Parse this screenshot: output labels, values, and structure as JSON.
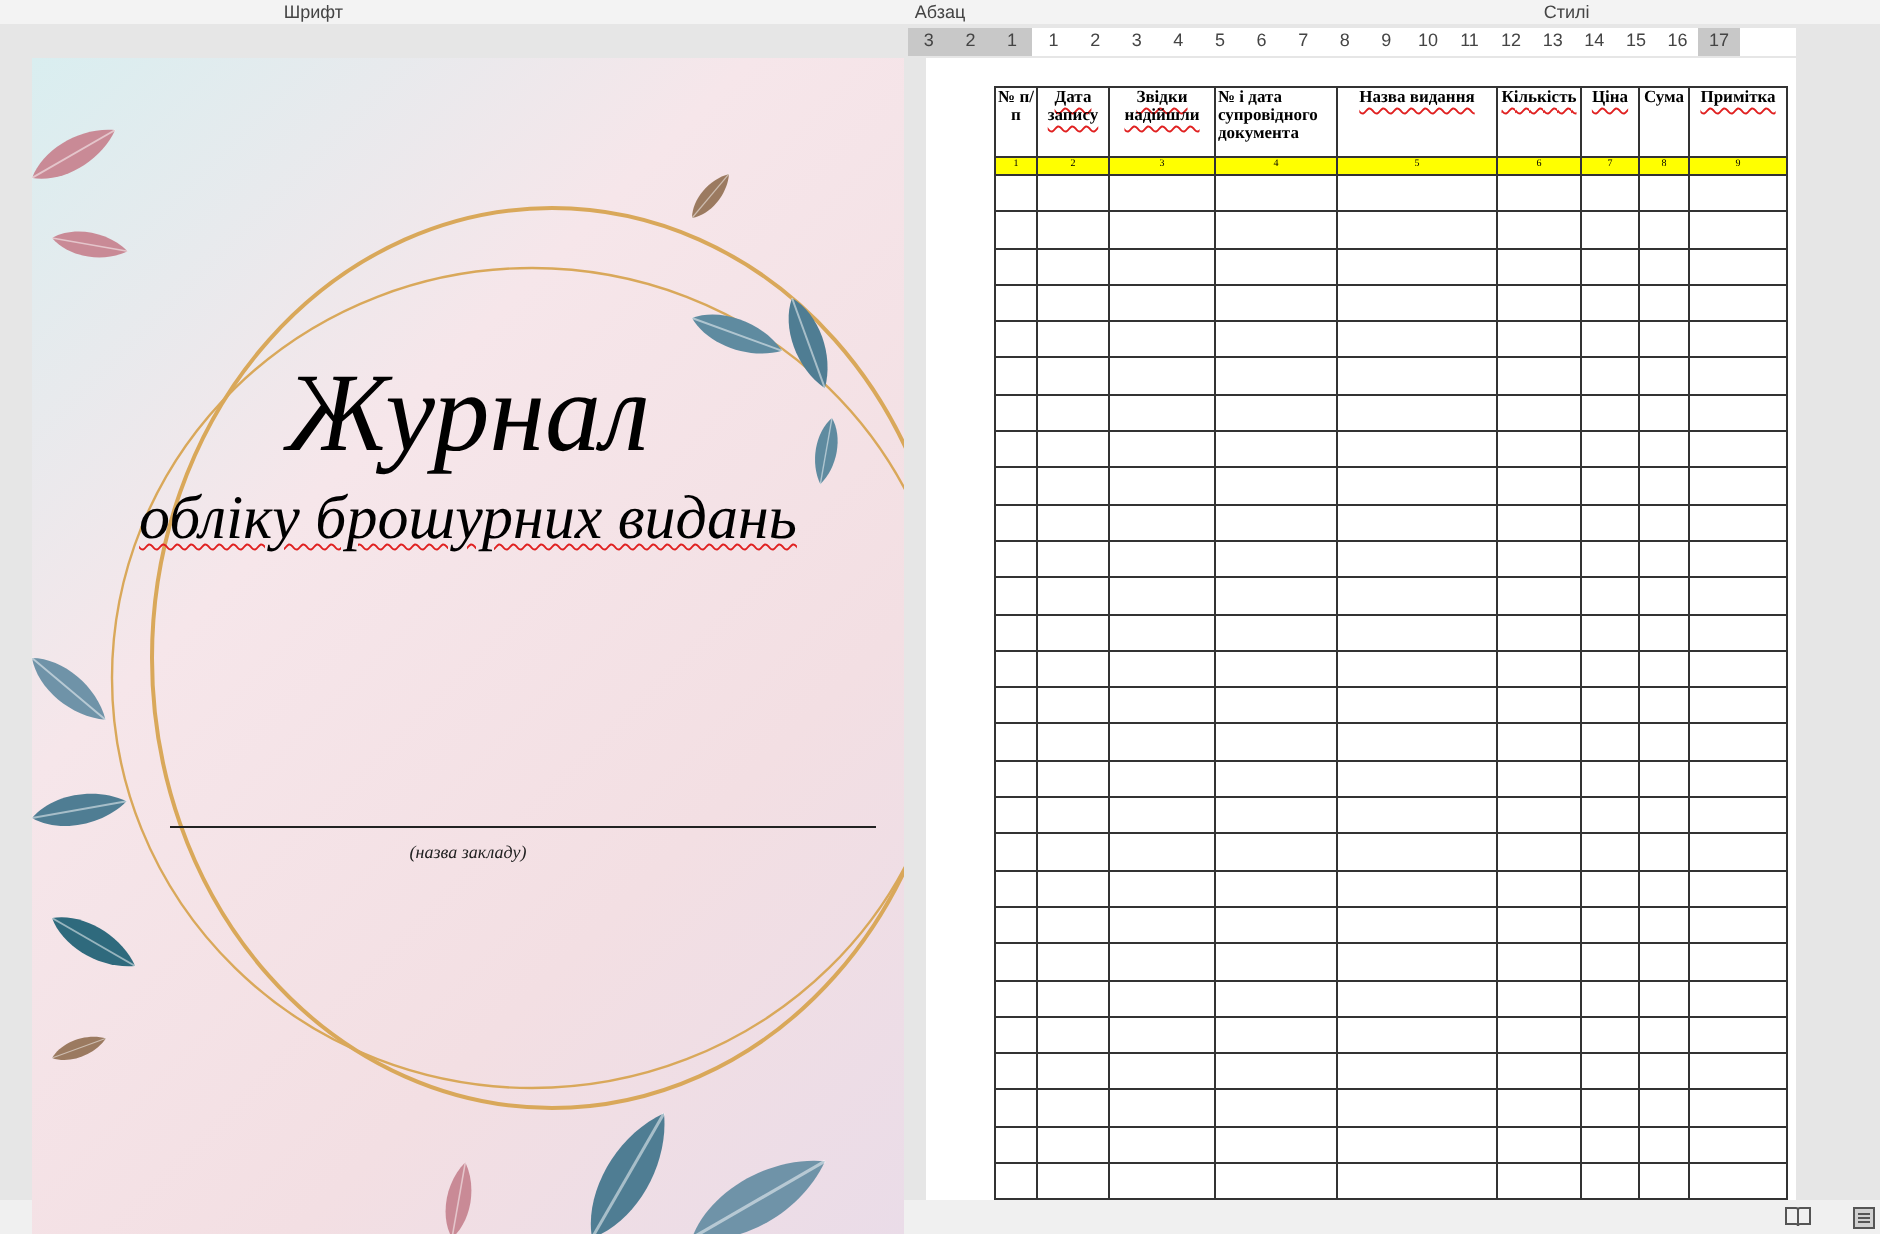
{
  "ribbon": {
    "groups": [
      "Шрифт",
      "Абзац",
      "Стилі"
    ]
  },
  "ruler": {
    "labels": [
      "3",
      "2",
      "1",
      "1",
      "2",
      "3",
      "4",
      "5",
      "6",
      "7",
      "8",
      "9",
      "10",
      "11",
      "12",
      "13",
      "14",
      "15",
      "16",
      "17"
    ]
  },
  "cover": {
    "title": "Журнал",
    "subtitle": "обліку брошурних видань",
    "subtitle_misspelled": true,
    "caption": "(назва закладу)"
  },
  "table": {
    "columns": [
      {
        "header": "№ п/п",
        "number": "1",
        "misspelled": false
      },
      {
        "header": "Дата запису",
        "number": "2",
        "misspelled": true
      },
      {
        "header": "Звідки надійшли",
        "number": "3",
        "misspelled": true
      },
      {
        "header": "№ і дата супровідного документа",
        "number": "4",
        "misspelled": false
      },
      {
        "header": "Назва видання",
        "number": "5",
        "misspelled": true
      },
      {
        "header": "Кількість",
        "number": "6",
        "misspelled": true
      },
      {
        "header": "Ціна",
        "number": "7",
        "misspelled": true
      },
      {
        "header": "Сума",
        "number": "8",
        "misspelled": false
      },
      {
        "header": "Примітка",
        "number": "9",
        "misspelled": true
      }
    ]
  }
}
